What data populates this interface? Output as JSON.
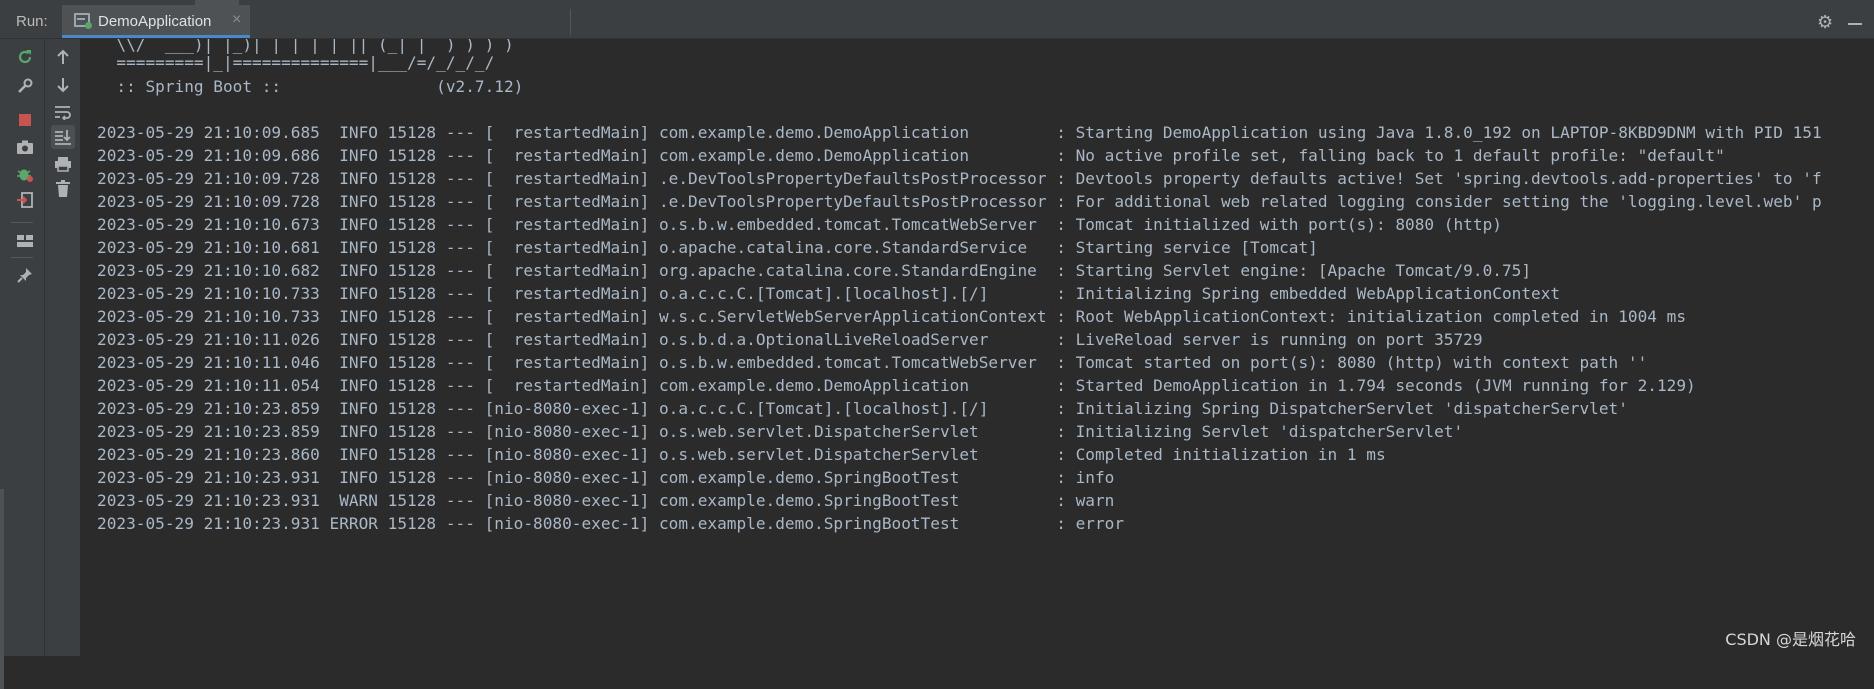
{
  "toolbar": {
    "run_label": "Run:",
    "tab_title": "DemoApplication",
    "tab_close": "×",
    "settings_icon": "gear-icon",
    "hide_icon": "minimize-icon"
  },
  "console": {
    "banner": [
      "  =========|_|==============|___/=/_/_/_/",
      "  :: Spring Boot ::                (v2.7.12)"
    ],
    "logs": [
      "2023-05-29 21:10:09.685  INFO 15128 --- [  restartedMain] com.example.demo.DemoApplication         : Starting DemoApplication using Java 1.8.0_192 on LAPTOP-8KBD9DNM with PID 151",
      "2023-05-29 21:10:09.686  INFO 15128 --- [  restartedMain] com.example.demo.DemoApplication         : No active profile set, falling back to 1 default profile: \"default\"",
      "2023-05-29 21:10:09.728  INFO 15128 --- [  restartedMain] .e.DevToolsPropertyDefaultsPostProcessor : Devtools property defaults active! Set 'spring.devtools.add-properties' to 'f",
      "2023-05-29 21:10:09.728  INFO 15128 --- [  restartedMain] .e.DevToolsPropertyDefaultsPostProcessor : For additional web related logging consider setting the 'logging.level.web' p",
      "2023-05-29 21:10:10.673  INFO 15128 --- [  restartedMain] o.s.b.w.embedded.tomcat.TomcatWebServer  : Tomcat initialized with port(s): 8080 (http)",
      "2023-05-29 21:10:10.681  INFO 15128 --- [  restartedMain] o.apache.catalina.core.StandardService   : Starting service [Tomcat]",
      "2023-05-29 21:10:10.682  INFO 15128 --- [  restartedMain] org.apache.catalina.core.StandardEngine  : Starting Servlet engine: [Apache Tomcat/9.0.75]",
      "2023-05-29 21:10:10.733  INFO 15128 --- [  restartedMain] o.a.c.c.C.[Tomcat].[localhost].[/]       : Initializing Spring embedded WebApplicationContext",
      "2023-05-29 21:10:10.733  INFO 15128 --- [  restartedMain] w.s.c.ServletWebServerApplicationContext : Root WebApplicationContext: initialization completed in 1004 ms",
      "2023-05-29 21:10:11.026  INFO 15128 --- [  restartedMain] o.s.b.d.a.OptionalLiveReloadServer       : LiveReload server is running on port 35729",
      "2023-05-29 21:10:11.046  INFO 15128 --- [  restartedMain] o.s.b.w.embedded.tomcat.TomcatWebServer  : Tomcat started on port(s): 8080 (http) with context path ''",
      "2023-05-29 21:10:11.054  INFO 15128 --- [  restartedMain] com.example.demo.DemoApplication         : Started DemoApplication in 1.794 seconds (JVM running for 2.129)",
      "2023-05-29 21:10:23.859  INFO 15128 --- [nio-8080-exec-1] o.a.c.c.C.[Tomcat].[localhost].[/]       : Initializing Spring DispatcherServlet 'dispatcherServlet'",
      "2023-05-29 21:10:23.859  INFO 15128 --- [nio-8080-exec-1] o.s.web.servlet.DispatcherServlet        : Initializing Servlet 'dispatcherServlet'",
      "2023-05-29 21:10:23.860  INFO 15128 --- [nio-8080-exec-1] o.s.web.servlet.DispatcherServlet        : Completed initialization in 1 ms",
      "2023-05-29 21:10:23.931  INFO 15128 --- [nio-8080-exec-1] com.example.demo.SpringBootTest          : info",
      "2023-05-29 21:10:23.931  WARN 15128 --- [nio-8080-exec-1] com.example.demo.SpringBootTest          : warn",
      "2023-05-29 21:10:23.931 ERROR 15128 --- [nio-8080-exec-1] com.example.demo.SpringBootTest          : error"
    ]
  },
  "watermark": "CSDN @是烟花哈",
  "colors": {
    "background": "#2b2b2b",
    "panel": "#3c3f41",
    "log_text": "#a9b7c6",
    "accent": "#4a88c7",
    "rerun_green": "#59a869",
    "stop_red": "#c75450"
  }
}
